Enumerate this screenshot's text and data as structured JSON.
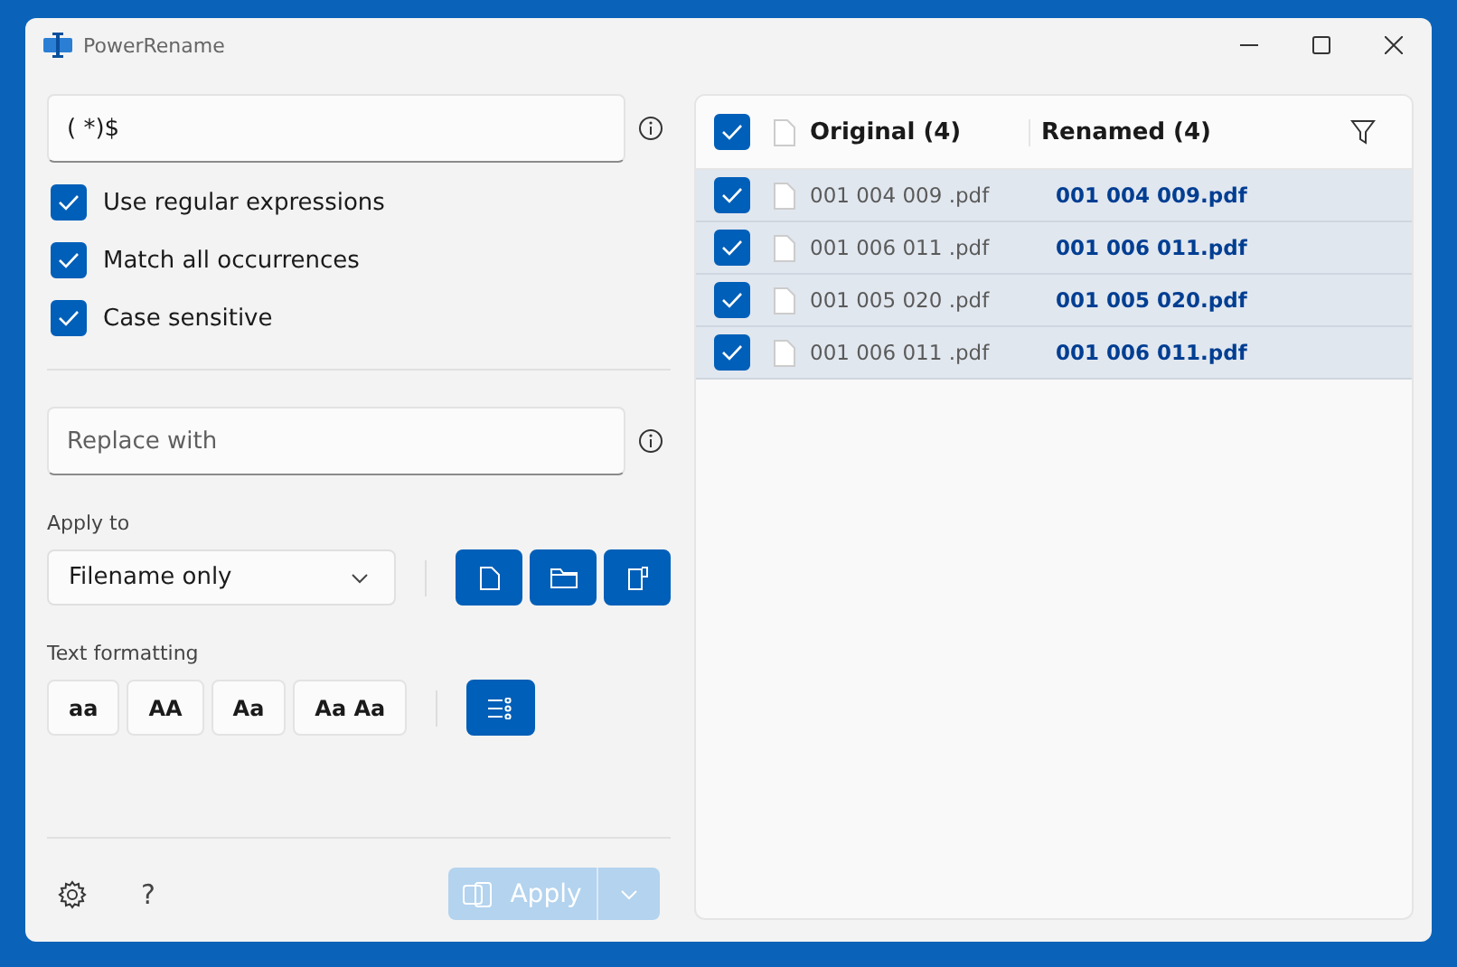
{
  "window": {
    "title": "PowerRename"
  },
  "search": {
    "value": "( *)$"
  },
  "options": [
    {
      "label": "Use regular expressions",
      "checked": true
    },
    {
      "label": "Match all occurrences",
      "checked": true
    },
    {
      "label": "Case sensitive",
      "checked": true
    }
  ],
  "replace": {
    "placeholder": "Replace with"
  },
  "apply_to": {
    "label": "Apply to",
    "value": "Filename only",
    "toggles": [
      {
        "kind": "files",
        "selected": true
      },
      {
        "kind": "folders",
        "selected": true
      },
      {
        "kind": "extension",
        "selected": true
      }
    ]
  },
  "text_formatting": {
    "label": "Text formatting",
    "buttons": [
      {
        "label": "aa",
        "selected": false
      },
      {
        "label": "AA",
        "selected": false
      },
      {
        "label": "Aa",
        "selected": false
      },
      {
        "label": "Aa Aa",
        "selected": false
      }
    ],
    "enumerate": {
      "selected": true
    }
  },
  "footer": {
    "help": "?",
    "apply": {
      "label": "Apply",
      "disabled": true
    }
  },
  "list": {
    "checked": true,
    "original": "Original (4)",
    "renamed": "Renamed (4)",
    "rows": [
      {
        "checked": true,
        "original": "001 004 009 .pdf",
        "renamed": "001 004 009.pdf"
      },
      {
        "checked": true,
        "original": "001 006 011 .pdf",
        "renamed": "001 006 011.pdf"
      },
      {
        "checked": true,
        "original": "001 005 020 .pdf",
        "renamed": "001 005 020.pdf"
      },
      {
        "checked": true,
        "original": "001 006 011 .pdf",
        "renamed": "001 006 011.pdf"
      }
    ]
  }
}
